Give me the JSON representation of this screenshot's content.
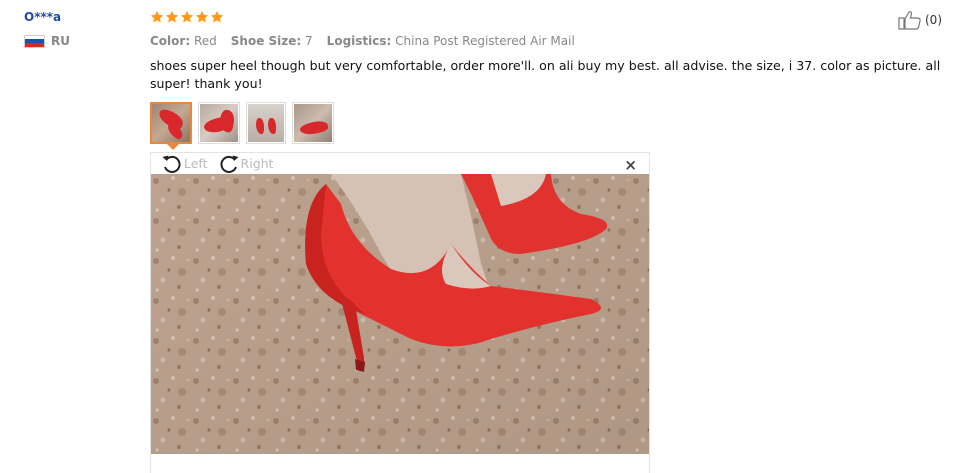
{
  "reviewer": {
    "name": "O***a",
    "country": "RU",
    "flag_colors": [
      "#ffffff",
      "#1e4fb0",
      "#d52b1e"
    ]
  },
  "review": {
    "rating": 5,
    "star_color": "#ff9a16",
    "attributes": [
      {
        "key": "Color:",
        "value": "Red"
      },
      {
        "key": "Shoe Size:",
        "value": "7"
      },
      {
        "key": "Logistics:",
        "value": "China Post Registered Air Mail"
      }
    ],
    "helpful_count": "(0)",
    "comment": "shoes super heel though but very comfortable, order more'll. on ali buy my best. all advise. the size, i 37. color as picture. all super! thank you!",
    "thumbnails": [
      {
        "name": "photo-1",
        "active": true
      },
      {
        "name": "photo-2",
        "active": false
      },
      {
        "name": "photo-3",
        "active": false
      },
      {
        "name": "photo-4",
        "active": false
      }
    ]
  },
  "viewer": {
    "rotate_left_label": "Left",
    "rotate_right_label": "Right",
    "close_symbol": "×",
    "icons": [
      "rotate-left-icon",
      "rotate-right-icon",
      "close-icon",
      "thumbs-up-icon"
    ]
  }
}
